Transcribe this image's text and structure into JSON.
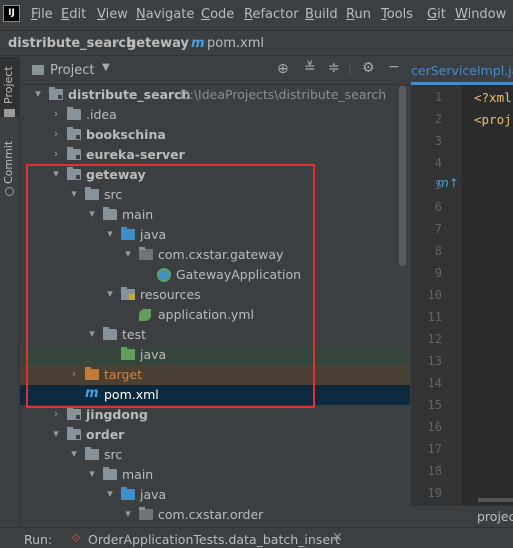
{
  "menubar": {
    "logo": "IJ",
    "items": [
      {
        "u": "F",
        "rest": "ile"
      },
      {
        "u": "E",
        "rest": "dit"
      },
      {
        "u": "V",
        "rest": "iew"
      },
      {
        "u": "N",
        "rest": "avigate"
      },
      {
        "u": "C",
        "rest": "ode"
      },
      {
        "u": "R",
        "rest": "efactor"
      },
      {
        "u": "B",
        "rest": "uild"
      },
      {
        "u": "R",
        "rest": "un"
      },
      {
        "u": "T",
        "rest": "ools"
      },
      {
        "u": "G",
        "rest": "it"
      },
      {
        "u": "W",
        "rest": "indow"
      }
    ]
  },
  "breadcrumb": {
    "project": "distribute_search",
    "module": "geteway",
    "file_icon": "m",
    "file": "pom.xml"
  },
  "left_strip": {
    "project_tab": "Project",
    "commit_tab": "Commit"
  },
  "panel_header": {
    "title": "Project",
    "dropdown_icon": "chevron-down-icon"
  },
  "tree": [
    {
      "name": "distribute_search",
      "path": "D:\\IdeaProjects\\distribute_search",
      "arrow": "▾",
      "icon": "module",
      "bold": true
    },
    {
      "name": ".idea",
      "arrow": "›",
      "icon": "folder"
    },
    {
      "name": "bookschina",
      "arrow": "›",
      "icon": "module",
      "bold": true
    },
    {
      "name": "eureka-server",
      "arrow": "›",
      "icon": "module",
      "bold": true
    },
    {
      "name": "geteway",
      "arrow": "▾",
      "icon": "module",
      "bold": true
    },
    {
      "name": "src",
      "arrow": "▾",
      "icon": "folder"
    },
    {
      "name": "main",
      "arrow": "▾",
      "icon": "folder"
    },
    {
      "name": "java",
      "arrow": "▾",
      "icon": "blue"
    },
    {
      "name": "com.cxstar.gateway",
      "arrow": "▾",
      "icon": "package"
    },
    {
      "name": "GatewayApplication",
      "arrow": "",
      "icon": "class"
    },
    {
      "name": "resources",
      "arrow": "▾",
      "icon": "resources"
    },
    {
      "name": "application.yml",
      "arrow": "",
      "icon": "yml"
    },
    {
      "name": "test",
      "arrow": "▾",
      "icon": "folder"
    },
    {
      "name": "java",
      "arrow": "",
      "icon": "green"
    },
    {
      "name": "target",
      "arrow": "›",
      "icon": "orange"
    },
    {
      "name": "pom.xml",
      "arrow": "",
      "icon": "maven"
    },
    {
      "name": "jingdong",
      "arrow": "›",
      "icon": "module",
      "bold": true
    },
    {
      "name": "order",
      "arrow": "▾",
      "icon": "module",
      "bold": true
    },
    {
      "name": "src",
      "arrow": "▾",
      "icon": "folder"
    },
    {
      "name": "main",
      "arrow": "▾",
      "icon": "folder"
    },
    {
      "name": "java",
      "arrow": "▾",
      "icon": "blue"
    },
    {
      "name": "com.cxstar.order",
      "arrow": "▾",
      "icon": "package"
    }
  ],
  "editor": {
    "tab_label": "cerServiceImpl.java",
    "line_numbers": [
      "1",
      "2",
      "3",
      "4",
      "5",
      "6",
      "7",
      "8",
      "9",
      "10",
      "11",
      "12",
      "13",
      "14",
      "15",
      "16",
      "17",
      "18",
      "19"
    ],
    "code_line1": "<?xml",
    "code_line2": "<proj",
    "gutter_marker": "m↑",
    "bottom_label": "projec"
  },
  "bottom_bar": {
    "run_label": "Run:",
    "run_config": "OrderApplicationTests.data_batch_insert"
  },
  "colors": {
    "background": "#3c3f41",
    "editor_background": "#2b2b2b",
    "selection": "#0d293e",
    "highlight_box": "#e03131",
    "test_row": "#36453b",
    "target_row": "#4a4034"
  }
}
